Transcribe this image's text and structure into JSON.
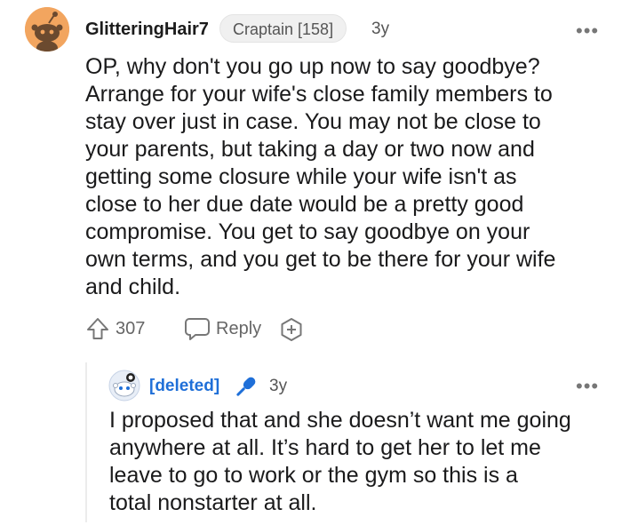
{
  "comment": {
    "username": "GlitteringHair7",
    "flair": "Craptain [158]",
    "age": "3y",
    "more": "•••",
    "lines": [
      "OP, why don't you go up now to say goodbye?",
      "Arrange for your wife's close family members to",
      "stay over just in case. You may not be close to",
      "your parents, but taking a day or two now and",
      "getting some closure while your wife isn't as",
      "close to her due date would be a pretty good",
      "compromise. You get to say goodbye on your",
      "own terms, and you get to be there for your wife",
      "and child."
    ],
    "upvotes": "307",
    "reply_label": "Reply"
  },
  "reply": {
    "username": "[deleted]",
    "age": "3y",
    "more": "•••",
    "lines": [
      "I proposed that and she doesn’t want me going",
      "anywhere at all. It’s hard to get her to let me",
      "leave to go to work or the gym so this is a",
      "total nonstarter at all."
    ]
  },
  "colors": {
    "avatar": "#f2a55f",
    "deleted_user": "#1f6fd8",
    "mic_icon": "#1f6fd8",
    "meta_text": "#555555",
    "thread_line": "#ececec"
  },
  "icons": [
    "snoo-avatar-icon",
    "upvote-arrow-icon",
    "comment-bubble-icon",
    "award-plus-icon",
    "deleted-avatar-icon",
    "microphone-icon",
    "more-options-icon"
  ]
}
